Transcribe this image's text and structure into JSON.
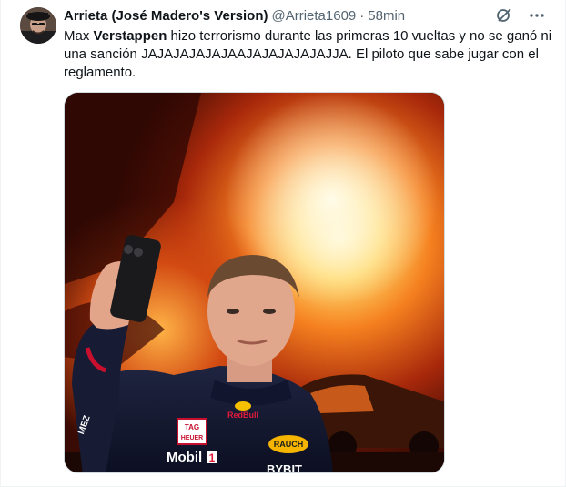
{
  "tweet": {
    "display_name": "Arrieta (José Madero's Version)",
    "handle": "@Arrieta1609",
    "separator": "·",
    "time": "58min",
    "text_part1": "Max ",
    "text_bold": "Verstappen",
    "text_part2": " hizo terrorismo durante las primeras 10 vueltas y no se ganó ni una sanción JAJAJAJAJAJAAJAJAJAJAJAJJA. El piloto que sabe jugar con el reglamento."
  },
  "media": {
    "logos": {
      "tag_line1": "TAG",
      "tag_line2": "HEUER",
      "redbull": "RedBull",
      "rauch": "RAUCH",
      "mobil": "Mobil",
      "mobil_suffix": "1",
      "bybit": "BYBIT",
      "sleeve": "MEZ"
    }
  },
  "icons": {
    "grok": "grok-icon",
    "more": "more-icon"
  }
}
